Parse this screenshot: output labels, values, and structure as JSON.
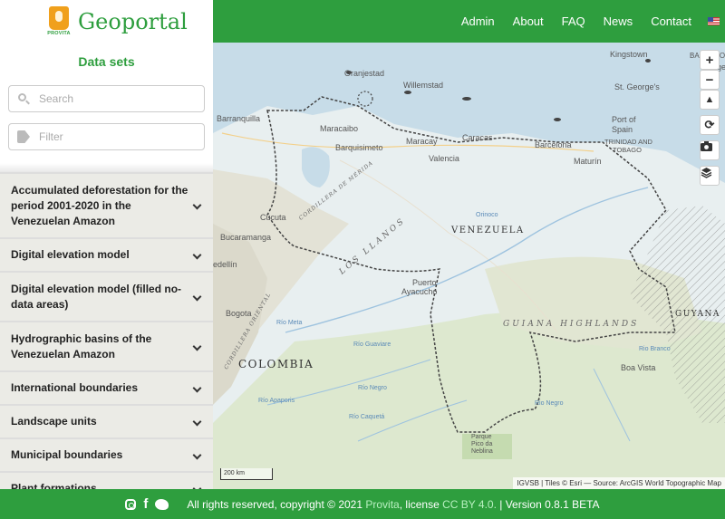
{
  "header": {
    "brand_name": "Geoportal",
    "logo_text": "PROVITA",
    "nav": [
      "Admin",
      "About",
      "FAQ",
      "News",
      "Contact"
    ],
    "language_flag": "us-flag-icon"
  },
  "sidebar": {
    "title": "Data sets",
    "search_placeholder": "Search",
    "filter_placeholder": "Filter",
    "layers": [
      "Accumulated deforestation for the period 2001-2020 in the Venezuelan Amazon",
      "Digital elevation model",
      "Digital elevation model (filled no-data areas)",
      "Hydrographic basins of the Venezuelan Amazon",
      "International boundaries",
      "Landscape units",
      "Municipal boundaries",
      "Plant formations"
    ]
  },
  "map": {
    "zoom_in": "+",
    "zoom_out": "−",
    "controls": [
      "compass-icon",
      "refresh-icon",
      "camera-icon",
      "layers-icon"
    ],
    "scale_label": "200 km",
    "attribution": "IGVSB | Tiles © Esri — Source: ArcGIS World Topographic Map",
    "labels": {
      "kingstown": "Kingstown",
      "barbados": "BARBADOS",
      "bridgetown": "Bridge",
      "oranjestad": "Oranjestad",
      "willemstad": "Willemstad",
      "st_georges": "St. George's",
      "port_of_spain_1": "Port of",
      "port_of_spain_2": "Spain",
      "trinidad_1": "TRINIDAD AND",
      "trinidad_2": "TOBAGO",
      "barranquilla": "Barranquilla",
      "maracaibo": "Maracaibo",
      "barquisimeto": "Barquisimeto",
      "maracay": "Maracay",
      "caracas": "Caracas",
      "barcelona": "Barcelona",
      "valencia": "Valencia",
      "maturin": "Maturín",
      "cucuta": "Cúcuta",
      "bucaramanga": "Bucaramanga",
      "medellin": "edellín",
      "bogota": "Bogota",
      "venezuela": "VENEZUELA",
      "los_llanos": "LOS LLANOS",
      "puerto_ayacucho_1": "Puerto",
      "puerto_ayacucho_2": "Ayacucho",
      "guiana_highlands": "GUIANA HIGHLANDS",
      "guyana": "GUYANA",
      "colombia": "COLOMBIA",
      "boa_vista": "Boa Vista",
      "pico_1": "Parque",
      "pico_2": "Pico da",
      "pico_3": "Neblina",
      "cordillera_merida": "CORDILLERA DE MÉRIDA",
      "cordillera_oriental": "CORDILLERA ORIENTAL",
      "rio_meta": "Río Meta",
      "rio_guaviare": "Río Guaviare",
      "rio_negro": "Río Negro",
      "rio_negro_2": "Rio Negro",
      "rio_apaporis": "Río Apaporis",
      "rio_branco": "Rio Branco",
      "rio_caqueta": "Río Caquetá",
      "orinoco": "Orinoco"
    }
  },
  "footer": {
    "text_prefix": "All rights reserved, copyright © 2021",
    "provita": "Provita",
    "license_text": ", license",
    "license": "CC BY 4.0.",
    "version": "| Version 0.8.1 BETA"
  },
  "colors": {
    "brand_green": "#2e9e3e",
    "layer_bg": "#ebebe6"
  }
}
